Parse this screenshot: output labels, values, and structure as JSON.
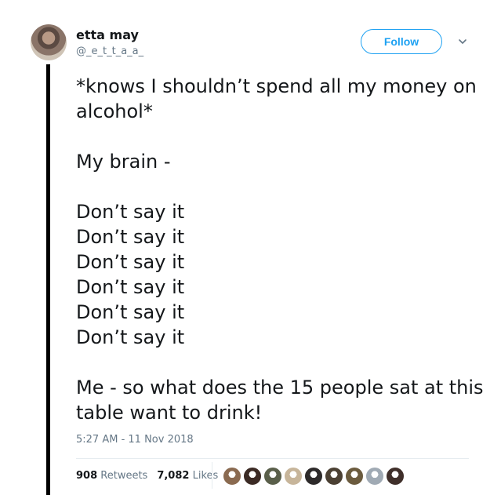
{
  "author": {
    "display_name": "etta may",
    "handle": "@_e_t_t_a_a_"
  },
  "follow_label": "Follow",
  "tweet": {
    "text": "*knows I shouldn’t spend all my money on alcohol*\n\nMy brain -\n\nDon’t say it\nDon’t say it\nDon’t say it\nDon’t say it\nDon’t say it\nDon’t say it\n\nMe - so what does the 15 people sat at this table want to drink!",
    "timestamp": "5:27 AM - 11 Nov 2018"
  },
  "stats": {
    "retweets_count": "908",
    "retweets_label": "Retweets",
    "likes_count": "7,082",
    "likes_label": "Likes"
  },
  "likers": [
    "#8a6a50",
    "#3b2a24",
    "#5a5f4a",
    "#c7b59a",
    "#2d2a2a",
    "#4b4033",
    "#6b5b3e",
    "#a0aab4",
    "#3f2f2a"
  ],
  "colors": {
    "accent": "#1da1f2",
    "secondary_text": "#657786",
    "thread_line": "#000000"
  }
}
